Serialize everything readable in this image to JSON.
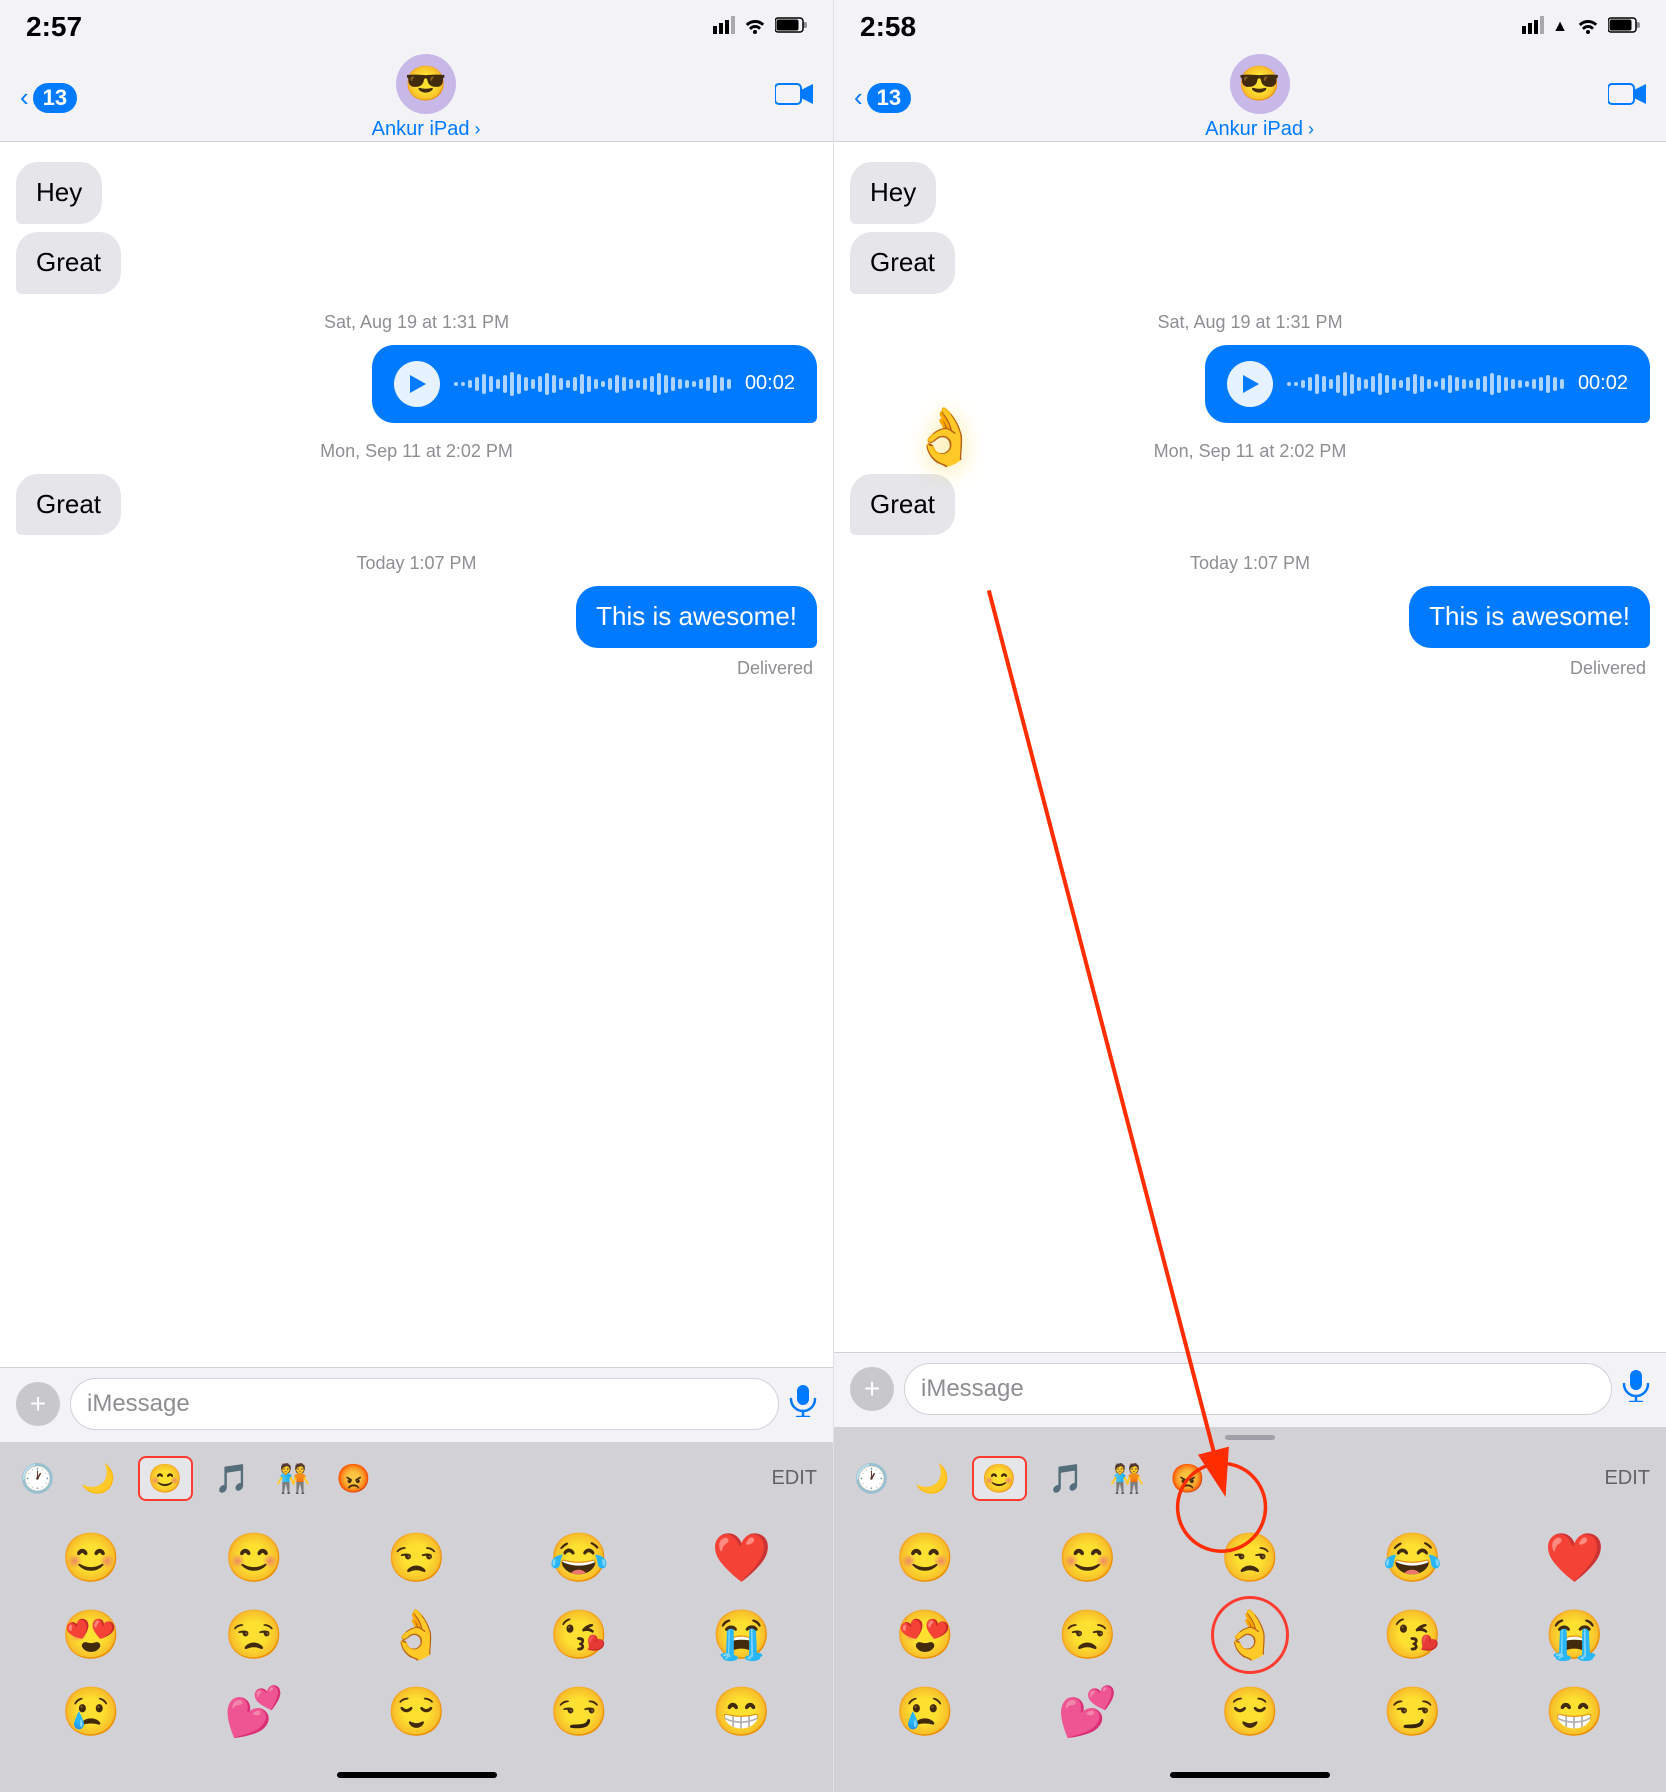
{
  "left_panel": {
    "status": {
      "time": "2:57",
      "signal": "📶",
      "wifi": "WiFi",
      "battery": "🔋"
    },
    "nav": {
      "back_count": "13",
      "contact_name": "Ankur iPad",
      "contact_emoji": "😎"
    },
    "messages": [
      {
        "type": "received",
        "text": "Hey"
      },
      {
        "type": "received",
        "text": "Great"
      },
      {
        "type": "timestamp",
        "text": "Sat, Aug 19 at 1:31 PM"
      },
      {
        "type": "voice",
        "duration": "00:02"
      },
      {
        "type": "timestamp",
        "text": "Mon, Sep 11 at 2:02 PM"
      },
      {
        "type": "received",
        "text": "Great"
      },
      {
        "type": "timestamp",
        "text": "Today 1:07 PM"
      },
      {
        "type": "sent",
        "text": "This is awesome!"
      },
      {
        "type": "delivered",
        "text": "Delivered"
      }
    ],
    "input": {
      "placeholder": "iMessage",
      "plus_label": "+",
      "mic_label": "🎙"
    },
    "emoji_keyboard": {
      "tabs": [
        "🕐",
        "🌙",
        "😊",
        "🎵",
        "🧑‍🤝‍🧑",
        "😡"
      ],
      "edit_label": "EDIT",
      "active_tab_index": 2,
      "emojis": [
        "😊",
        "😊",
        "😒",
        "😂",
        "❤️",
        "😍",
        "😒",
        "👌",
        "😘",
        "😭",
        "😢",
        "💕",
        "😌",
        "😏",
        "😁"
      ]
    },
    "home_bar": true
  },
  "right_panel": {
    "status": {
      "time": "2:58",
      "signal": "📶",
      "wifi": "WiFi",
      "battery": "🔋"
    },
    "nav": {
      "back_count": "13",
      "contact_name": "Ankur iPad",
      "contact_emoji": "😎"
    },
    "messages": [
      {
        "type": "received",
        "text": "Hey"
      },
      {
        "type": "received",
        "text": "Great"
      },
      {
        "type": "timestamp",
        "text": "Sat, Aug 19 at 1:31 PM"
      },
      {
        "type": "voice",
        "duration": "00:02"
      },
      {
        "type": "timestamp",
        "text": "Mon, Sep 11 at 2:02 PM"
      },
      {
        "type": "received",
        "text": "Great"
      },
      {
        "type": "timestamp",
        "text": "Today 1:07 PM"
      },
      {
        "type": "sent",
        "text": "This is awesome!"
      },
      {
        "type": "delivered",
        "text": "Delivered"
      }
    ],
    "input": {
      "placeholder": "iMessage",
      "plus_label": "+",
      "mic_label": "🎙"
    },
    "emoji_keyboard": {
      "tabs": [
        "🕐",
        "🌙",
        "😊",
        "🎵",
        "🧑‍🤝‍🧑",
        "😡"
      ],
      "edit_label": "EDIT",
      "active_tab_index": 2,
      "emojis": [
        "😊",
        "😊",
        "😒",
        "😂",
        "❤️",
        "😍",
        "😒",
        "👌",
        "😘",
        "😭",
        "😢",
        "💕",
        "😌",
        "😏",
        "😁"
      ]
    },
    "annotation": {
      "floating_emoji": "👌",
      "arrow_label": "→",
      "circle_emoji_index": 7
    },
    "home_bar": true
  },
  "wave_bars": [
    2,
    4,
    8,
    14,
    20,
    16,
    10,
    18,
    24,
    20,
    14,
    10,
    16,
    22,
    18,
    12,
    8,
    14,
    20,
    16,
    10,
    6,
    12,
    18,
    14,
    10,
    8,
    12,
    16,
    22,
    18,
    14,
    10,
    8,
    6,
    10,
    14,
    18,
    14,
    10
  ]
}
